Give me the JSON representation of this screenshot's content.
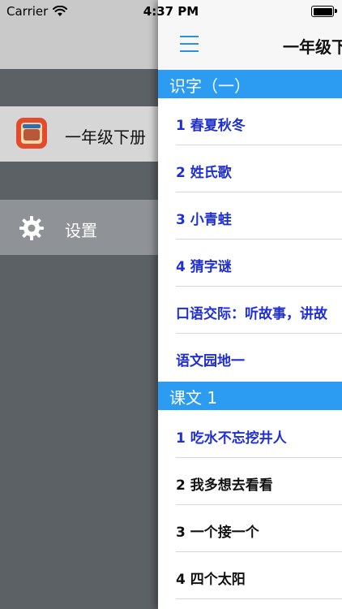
{
  "status_bar": {
    "carrier": "Carrier",
    "time": "4:37 PM"
  },
  "drawer": {
    "items": [
      {
        "label": "一年级下册",
        "icon": "book-cover-icon"
      },
      {
        "label": "设置",
        "icon": "gear-icon"
      }
    ]
  },
  "main": {
    "nav_title": "一年级下",
    "sections": [
      {
        "title": "识字（一）",
        "rows": [
          {
            "label": "1 春夏秋冬",
            "color": "#1f2fd1"
          },
          {
            "label": "2 姓氏歌",
            "color": "#1f2fd1"
          },
          {
            "label": "3 小青蛙",
            "color": "#1f2fd1"
          },
          {
            "label": "4 猜字谜",
            "color": "#1f2fd1"
          },
          {
            "label": "口语交际：听故事，讲故",
            "color": "#1f2fd1"
          },
          {
            "label": "语文园地一",
            "color": "#1f2fd1"
          }
        ]
      },
      {
        "title": "课文 1",
        "rows": [
          {
            "label": "1 吃水不忘挖井人",
            "color": "#1f2fd1"
          },
          {
            "label": "2 我多想去看看",
            "color": "#111111"
          },
          {
            "label": "3 一个接一个",
            "color": "#111111"
          },
          {
            "label": "4 四个太阳",
            "color": "#111111"
          }
        ]
      }
    ]
  },
  "colors": {
    "accent": "#2c9cf2",
    "link_blue": "#1f2fd1",
    "drawer_bg": "#5c6166"
  }
}
